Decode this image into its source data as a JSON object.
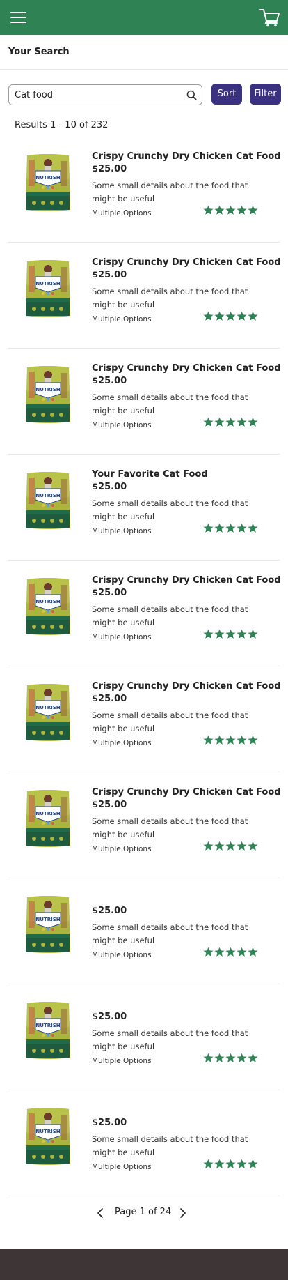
{
  "header": {
    "menu_icon": "hamburger-menu-icon",
    "cart_icon": "shopping-cart-icon"
  },
  "page_title": "Your Search",
  "search": {
    "value": "Cat food",
    "placeholder": "",
    "icon": "search-icon"
  },
  "toolbar": {
    "sort_label": "Sort",
    "filter_label": "Filter"
  },
  "results_text": "Results 1 - 10 of 232",
  "products": [
    {
      "name": "Crispy Crunchy Dry Chicken Cat Food",
      "price": "$25.00",
      "description": "Some small details about the food that might be useful",
      "options": "Multiple Options",
      "rating": 5
    },
    {
      "name": "Crispy Crunchy Dry Chicken Cat Food",
      "price": "$25.00",
      "description": "Some small details about the food that might be useful",
      "options": "Multiple Options",
      "rating": 5
    },
    {
      "name": "Crispy Crunchy Dry Chicken Cat Food",
      "price": "$25.00",
      "description": "Some small details about the food that might be useful",
      "options": "Multiple Options",
      "rating": 5
    },
    {
      "name": "Your Favorite Cat Food",
      "price": "$25.00",
      "description": "Some small details about the food that might be useful",
      "options": "Multiple Options",
      "rating": 5
    },
    {
      "name": "Crispy Crunchy Dry Chicken Cat Food",
      "price": "$25.00",
      "description": "Some small details about the food that might be useful",
      "options": "Multiple Options",
      "rating": 5
    },
    {
      "name": "Crispy Crunchy Dry Chicken Cat Food",
      "price": "$25.00",
      "description": "Some small details about the food that might be useful",
      "options": "Multiple Options",
      "rating": 5
    },
    {
      "name": "Crispy Crunchy Dry Chicken Cat Food",
      "price": "$25.00",
      "description": "Some small details about the food that might be useful",
      "options": "Multiple Options",
      "rating": 5
    },
    {
      "name": "",
      "price": "$25.00",
      "description": "Some small details about the food that might be useful",
      "options": "Multiple Options",
      "rating": 5
    },
    {
      "name": "",
      "price": "$25.00",
      "description": "Some small details about the food that might be useful",
      "options": "Multiple Options",
      "rating": 5
    },
    {
      "name": "",
      "price": "$25.00",
      "description": "Some small details about the food that might be useful",
      "options": "Multiple Options",
      "rating": 5
    }
  ],
  "product_image_label": "NUTRISH",
  "pagination": {
    "text": "Page 1 of 24",
    "prev_icon": "chevron-left-icon",
    "next_icon": "chevron-right-icon"
  },
  "colors": {
    "header": "#2e8253",
    "button": "#3a3180",
    "star": "#2e8253",
    "footer": "#3d3536"
  }
}
